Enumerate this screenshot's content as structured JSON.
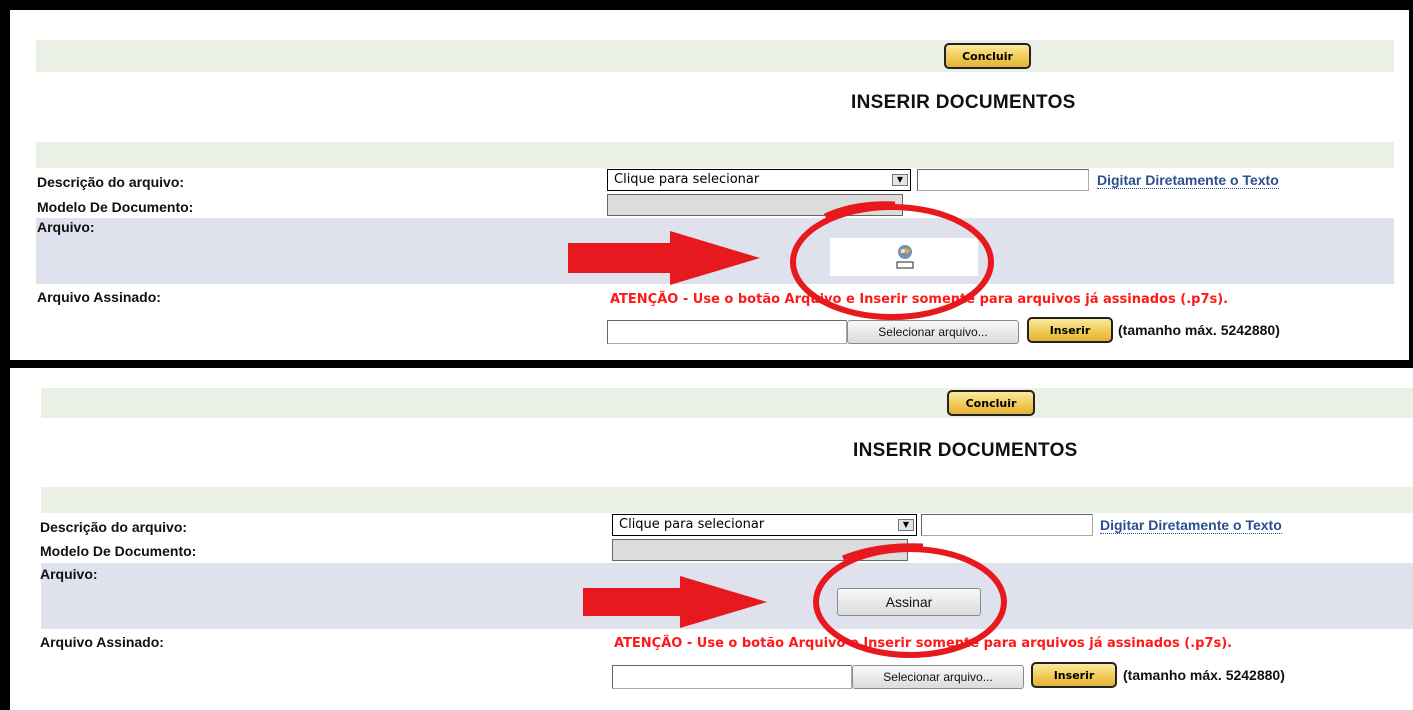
{
  "panels": [
    {
      "concluir_label": "Concluir",
      "title": "INSERIR DOCUMENTOS",
      "descricao_label": "Descrição do arquivo:",
      "descricao_select_value": "Clique para selecionar",
      "digitar_link": "Digitar Diretamente o Texto",
      "modelo_label": "Modelo De Documento:",
      "arquivo_label": "Arquivo:",
      "arquivo_assinado_label": "Arquivo Assinado:",
      "warning": "ATENÇÃO - Use o botão Arquivo e Inserir somente para arquivos já assinados (.p7s).",
      "selecionar_label": "Selecionar arquivo...",
      "inserir_label": "Inserir",
      "size_note": "(tamanho máx. 5242880)"
    },
    {
      "concluir_label": "Concluir",
      "title": "INSERIR DOCUMENTOS",
      "descricao_label": "Descrição do arquivo:",
      "descricao_select_value": "Clique para selecionar",
      "digitar_link": "Digitar Diretamente o Texto",
      "modelo_label": "Modelo De Documento:",
      "arquivo_label": "Arquivo:",
      "assinar_label": "Assinar",
      "arquivo_assinado_label": "Arquivo Assinado:",
      "warning": "ATENÇÃO - Use o botão Arquivo e Inserir somente para arquivos já assinados (.p7s).",
      "selecionar_label": "Selecionar arquivo...",
      "inserir_label": "Inserir",
      "size_note": "(tamanho máx. 5242880)"
    }
  ],
  "annotation_color": "#e8191e",
  "icons": {
    "plugin_loading": "java-applet-loading-icon",
    "arrow": "red-arrow-icon",
    "circle": "red-circle-highlight"
  }
}
